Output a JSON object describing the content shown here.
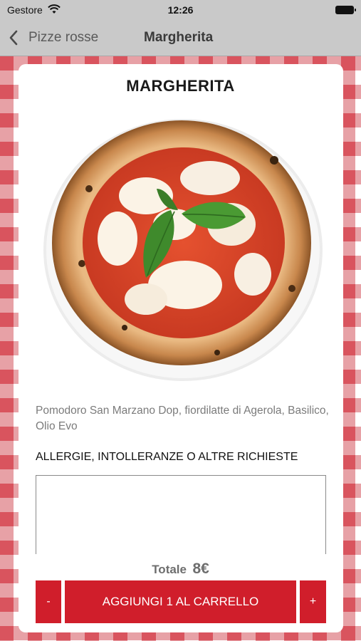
{
  "status_bar": {
    "carrier": "Gestore",
    "time": "12:26"
  },
  "nav": {
    "back_label": "Pizze rosse",
    "title": "Margherita"
  },
  "product": {
    "title": "MARGHERITA",
    "description": "Pomodoro San Marzano Dop, fiordilatte di Agerola, Basilico, Olio Evo"
  },
  "requests": {
    "label": "ALLERGIE, INTOLLERANZE O ALTRE RICHIESTE",
    "value": ""
  },
  "total": {
    "label": "Totale",
    "value": "8€"
  },
  "actions": {
    "minus": "-",
    "add_to_cart": "AGGIUNGI 1 AL CARRELLO",
    "plus": "+"
  },
  "colors": {
    "accent": "#d01e2b",
    "bar": "#c9c9c9",
    "checker": "#e0707a"
  }
}
